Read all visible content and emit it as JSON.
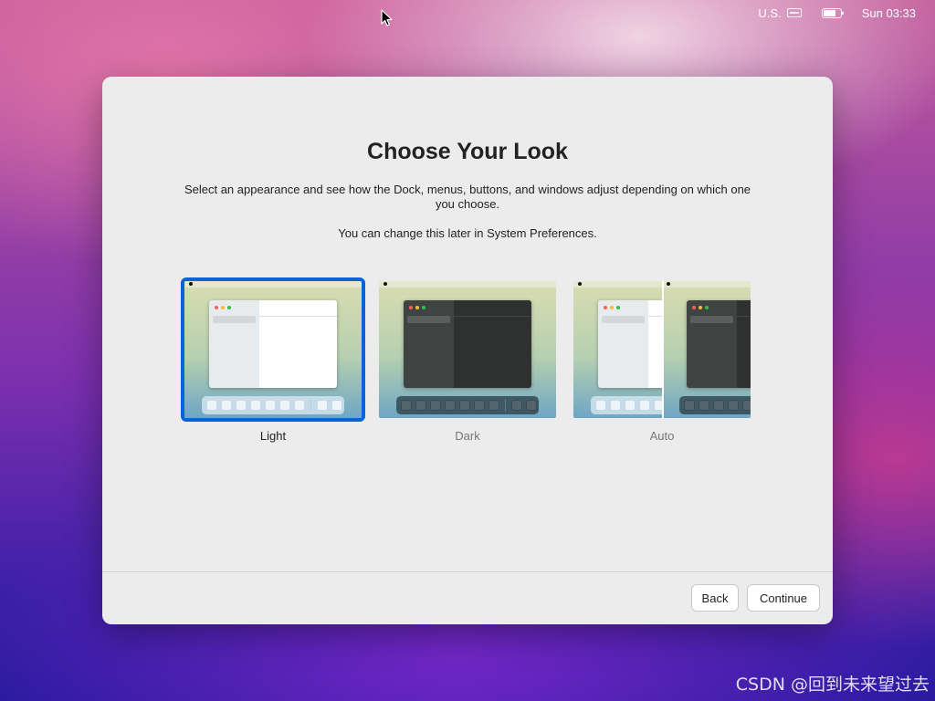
{
  "menubar": {
    "input_source": "U.S.",
    "clock": "Sun 03:33"
  },
  "dialog": {
    "title": "Choose Your Look",
    "description": "Select an appearance and see how the Dock, menus, buttons, and windows adjust depending on which one you choose.",
    "note": "You can change this later in System Preferences.",
    "options": [
      {
        "label": "Light",
        "selected": true
      },
      {
        "label": "Dark",
        "selected": false
      },
      {
        "label": "Auto",
        "selected": false
      }
    ],
    "buttons": {
      "back": "Back",
      "continue": "Continue"
    }
  },
  "watermark": "CSDN @回到未来望过去",
  "colors": {
    "selection": "#0a64d8"
  }
}
